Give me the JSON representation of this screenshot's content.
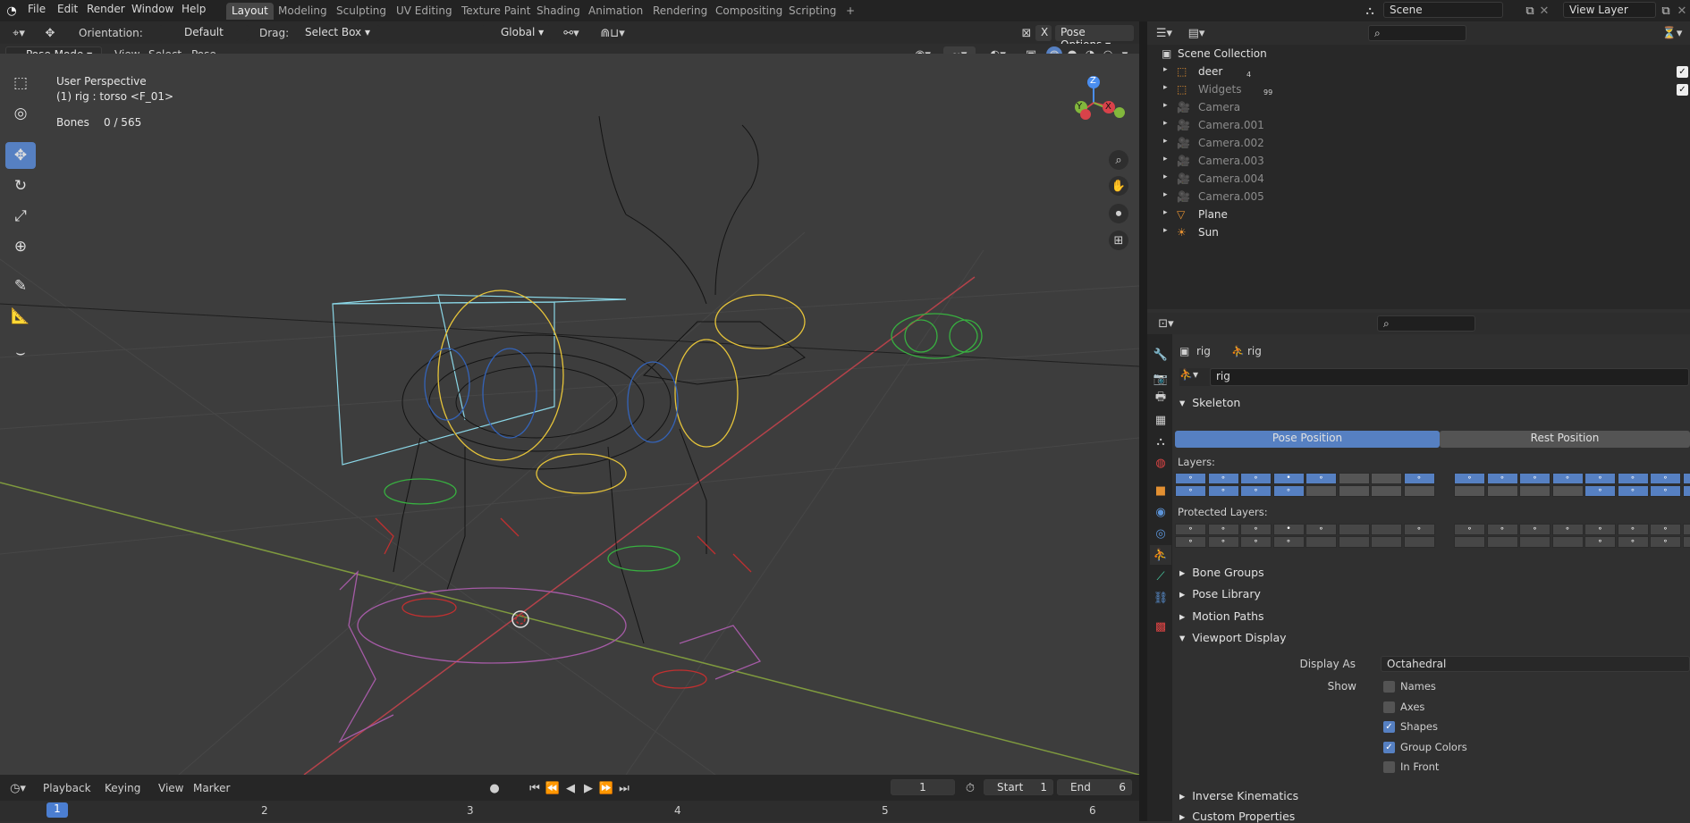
{
  "topbar": {
    "menus": [
      "File",
      "Edit",
      "Render",
      "Window",
      "Help"
    ],
    "workspaces": [
      "Layout",
      "Modeling",
      "Sculpting",
      "UV Editing",
      "Texture Paint",
      "Shading",
      "Animation",
      "Rendering",
      "Compositing",
      "Scripting"
    ],
    "add_tab": "+",
    "scene_label": "Scene",
    "view_layer_label": "View Layer"
  },
  "header": {
    "orientation_label": "Orientation:",
    "orientation_value": "Default",
    "drag_label": "Drag:",
    "drag_value": "Select Box",
    "transform_orientation": "Global",
    "pose_options": "Pose Options",
    "close_x": "X"
  },
  "viewport_header": {
    "mode": "Pose Mode",
    "menus": [
      "View",
      "Select",
      "Pose"
    ]
  },
  "viewport": {
    "perspective": "User Perspective",
    "active": "(1) rig : torso <F_01>",
    "bones_label": "Bones",
    "bones_value": "0 / 565",
    "gizmo": {
      "z": "Z",
      "y": "Y",
      "x": "X"
    }
  },
  "outliner": {
    "search_placeholder": "",
    "root": "Scene Collection",
    "items": [
      {
        "label": "deer",
        "badge": "4",
        "dim": false
      },
      {
        "label": "Widgets",
        "badge": "99",
        "dim": true
      },
      {
        "label": "Camera",
        "badge": "",
        "dim": true
      },
      {
        "label": "Camera.001",
        "badge": "",
        "dim": true
      },
      {
        "label": "Camera.002",
        "badge": "",
        "dim": true
      },
      {
        "label": "Camera.003",
        "badge": "",
        "dim": true
      },
      {
        "label": "Camera.004",
        "badge": "",
        "dim": true
      },
      {
        "label": "Camera.005",
        "badge": "",
        "dim": true
      },
      {
        "label": "Plane",
        "badge": "",
        "dim": false
      },
      {
        "label": "Sun",
        "badge": "",
        "dim": false
      }
    ]
  },
  "properties": {
    "breadcrumb": [
      "rig",
      "rig"
    ],
    "data_name": "rig",
    "skeleton_title": "Skeleton",
    "pose_position": "Pose Position",
    "rest_position": "Rest Position",
    "layers_label": "Layers:",
    "protected_label": "Protected Layers:",
    "collapsed": [
      "Bone Groups",
      "Pose Library",
      "Motion Paths"
    ],
    "viewport_display_title": "Viewport Display",
    "display_as_label": "Display As",
    "display_as_value": "Octahedral",
    "show_label": "Show",
    "checks": [
      {
        "label": "Names",
        "on": false
      },
      {
        "label": "Axes",
        "on": false
      },
      {
        "label": "Shapes",
        "on": true
      },
      {
        "label": "Group Colors",
        "on": true
      },
      {
        "label": "In Front",
        "on": false
      }
    ],
    "after": [
      "Inverse Kinematics",
      "Custom Properties"
    ]
  },
  "timeline": {
    "menus": [
      "Playback",
      "Keying",
      "View",
      "Marker"
    ],
    "current_frame": "1",
    "start_label": "Start",
    "start_value": "1",
    "end_label": "End",
    "end_value": "6",
    "ruler": [
      "1",
      "2",
      "3",
      "4",
      "5",
      "6"
    ]
  }
}
